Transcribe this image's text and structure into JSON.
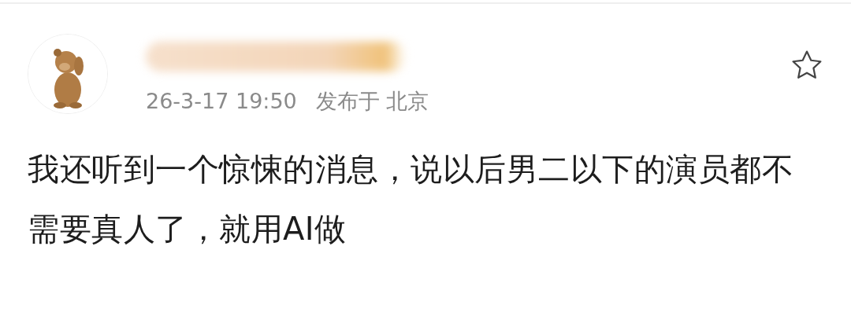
{
  "post": {
    "time": "26-3-17 19:50",
    "location": "发布于 北京",
    "starred": false,
    "text": "我还听到一个惊悚的消息，说以后男二以下的演员都不需要真人了，就用AI做"
  }
}
